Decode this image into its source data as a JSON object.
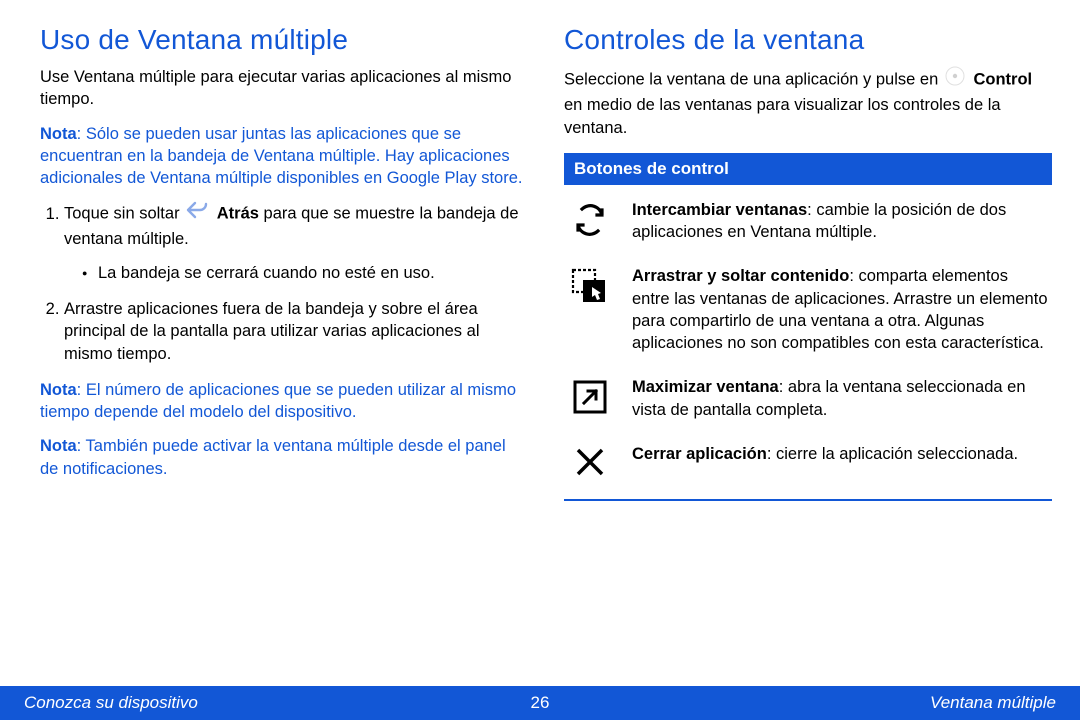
{
  "left": {
    "heading": "Uso de Ventana múltiple",
    "intro": "Use Ventana múltiple para ejecutar varias aplicaciones al mismo tiempo.",
    "note1_label": "Nota",
    "note1_body": ": Sólo se pueden usar juntas las aplicaciones que se encuentran en la bandeja de Ventana múltiple. Hay aplicaciones adicionales de Ventana múltiple disponibles en Google Play store.",
    "step1_pre": "Toque sin soltar ",
    "step1_bold": "Atrás",
    "step1_post": " para que se muestre la bandeja de ventana múltiple.",
    "step1_sub": "La bandeja se cerrará cuando no esté en uso.",
    "step2": "Arrastre aplicaciones fuera de la bandeja y sobre el área principal de la pantalla para utilizar varias aplicaciones al mismo tiempo.",
    "note2_label": "Nota",
    "note2_body": ": El número de aplicaciones que se pueden utilizar al mismo tiempo depende del modelo del dispositivo.",
    "note3_label": "Nota",
    "note3_body": ": También puede activar la ventana múltiple desde el panel de notificaciones."
  },
  "right": {
    "heading": "Controles de la ventana",
    "intro_pre": "Seleccione la ventana de una aplicación y pulse en ",
    "intro_bold": "Control",
    "intro_post": " en medio de las ventanas para visualizar los controles de la ventana.",
    "section": "Botones de control",
    "items": [
      {
        "bold": "Intercambiar ventanas",
        "rest": ": cambie la posición de dos aplicaciones en Ventana múltiple."
      },
      {
        "bold": "Arrastrar y soltar contenido",
        "rest": ": comparta elementos entre las ventanas de aplicaciones. Arrastre un elemento para compartirlo de una ventana a otra. Algunas aplicaciones no son compatibles con esta característica."
      },
      {
        "bold": "Maximizar ventana",
        "rest": ": abra la ventana seleccionada en vista de pantalla completa."
      },
      {
        "bold": "Cerrar aplicación",
        "rest": ": cierre la aplicación seleccionada."
      }
    ]
  },
  "footer": {
    "left": "Conozca su dispositivo",
    "page": "26",
    "right": "Ventana múltiple"
  }
}
